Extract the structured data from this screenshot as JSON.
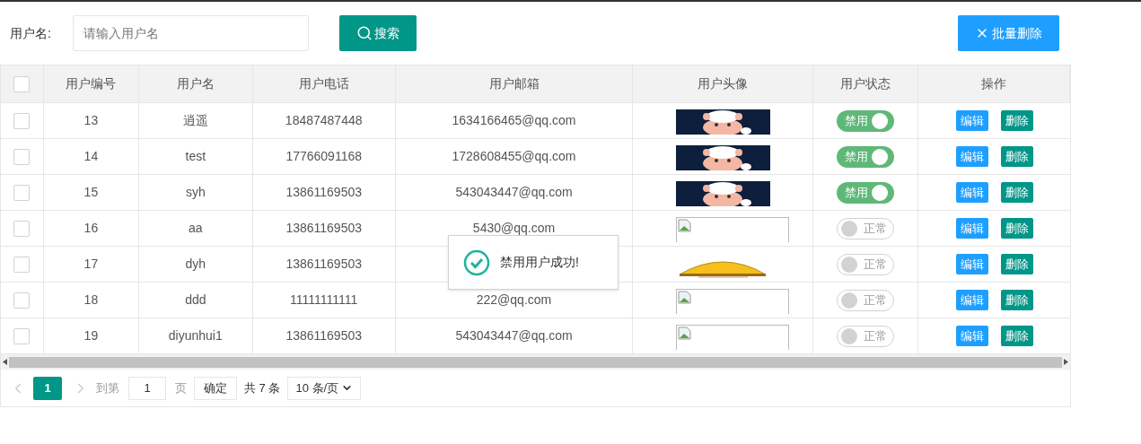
{
  "search": {
    "label": "用户名:",
    "placeholder": "请输入用户名",
    "button": "搜索"
  },
  "batch_delete": "批量删除",
  "table": {
    "select_all": {
      "checked": false
    },
    "columns": [
      "用户编号",
      "用户名",
      "用户电话",
      "用户邮箱",
      "用户头像",
      "用户状态",
      "操作"
    ],
    "rows": [
      {
        "checked": false,
        "id": "13",
        "name": "逍遥",
        "phone": "18487487448",
        "email": "1634166465@qq.com",
        "status": {
          "on": true,
          "label": "禁用"
        },
        "edit": "编辑",
        "delete": "删除"
      },
      {
        "checked": false,
        "id": "14",
        "name": "test",
        "phone": "17766091168",
        "email": "1728608455@qq.com",
        "status": {
          "on": true,
          "label": "禁用"
        },
        "edit": "编辑",
        "delete": "删除"
      },
      {
        "checked": false,
        "id": "15",
        "name": "syh",
        "phone": "13861169503",
        "email": "543043447@qq.com",
        "status": {
          "on": true,
          "label": "禁用"
        },
        "edit": "编辑",
        "delete": "删除"
      },
      {
        "checked": false,
        "id": "16",
        "name": "aa",
        "phone": "13861169503",
        "email": "5430@qq.com",
        "avatar": {
          "kind": "broken"
        },
        "status": {
          "on": false,
          "label": "正常"
        },
        "edit": "编辑",
        "delete": "删除"
      },
      {
        "checked": false,
        "id": "17",
        "name": "dyh",
        "phone": "13861169503",
        "status": {
          "on": false,
          "label": "正常"
        },
        "edit": "编辑",
        "delete": "删除"
      },
      {
        "checked": false,
        "id": "18",
        "name": "ddd",
        "phone": "11111111111",
        "email": "222@qq.com",
        "avatar": {
          "kind": "broken"
        },
        "status": {
          "on": false,
          "label": "正常"
        },
        "edit": "编辑",
        "delete": "删除"
      },
      {
        "checked": false,
        "id": "19",
        "name": "diyunhui1",
        "phone": "13861169503",
        "email": "543043447@qq.com",
        "avatar": {
          "kind": "broken"
        },
        "status": {
          "on": false,
          "label": "正常"
        },
        "edit": "编辑",
        "delete": "删除"
      }
    ]
  },
  "pagination": {
    "pages": [
      {
        "label": "1",
        "selected": true
      }
    ],
    "goto_label": "到第",
    "goto_value": "1",
    "page_unit": "页",
    "confirm": "确定",
    "total": "共 7 条",
    "page_size": "10 条/页"
  },
  "toast": {
    "message": "禁用用户成功!"
  }
}
